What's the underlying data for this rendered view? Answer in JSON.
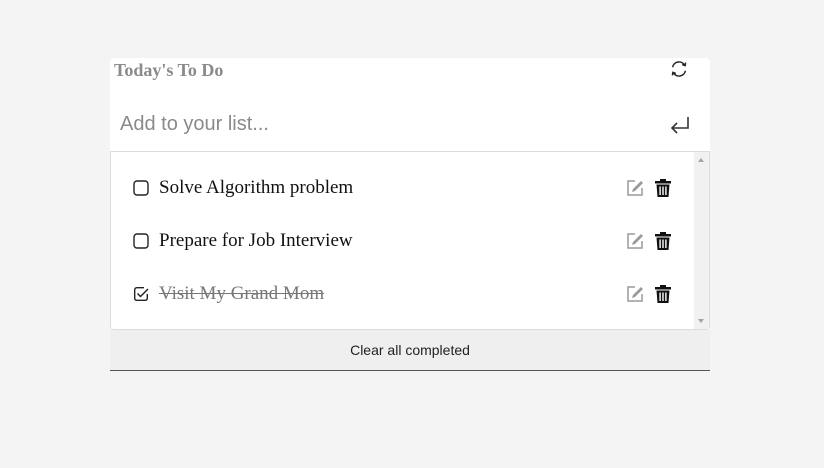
{
  "header": {
    "title": "Today's To Do",
    "refresh_icon": "refresh-icon"
  },
  "add": {
    "placeholder": "Add to your list...",
    "value": "",
    "enter_icon": "enter-return-icon"
  },
  "todos": [
    {
      "text": "Solve Algorithm problem",
      "completed": false
    },
    {
      "text": "Prepare for Job Interview",
      "completed": false
    },
    {
      "text": "Visit My Grand Mom",
      "completed": true
    }
  ],
  "item_icons": {
    "edit": "edit-pencil-icon",
    "delete": "trash-icon"
  },
  "footer": {
    "clear_label": "Clear all completed"
  },
  "colors": {
    "background": "#f4f4f4",
    "panel": "#ffffff",
    "title": "#8a8a8a",
    "completed_text": "#777777",
    "footer": "#efefef"
  }
}
